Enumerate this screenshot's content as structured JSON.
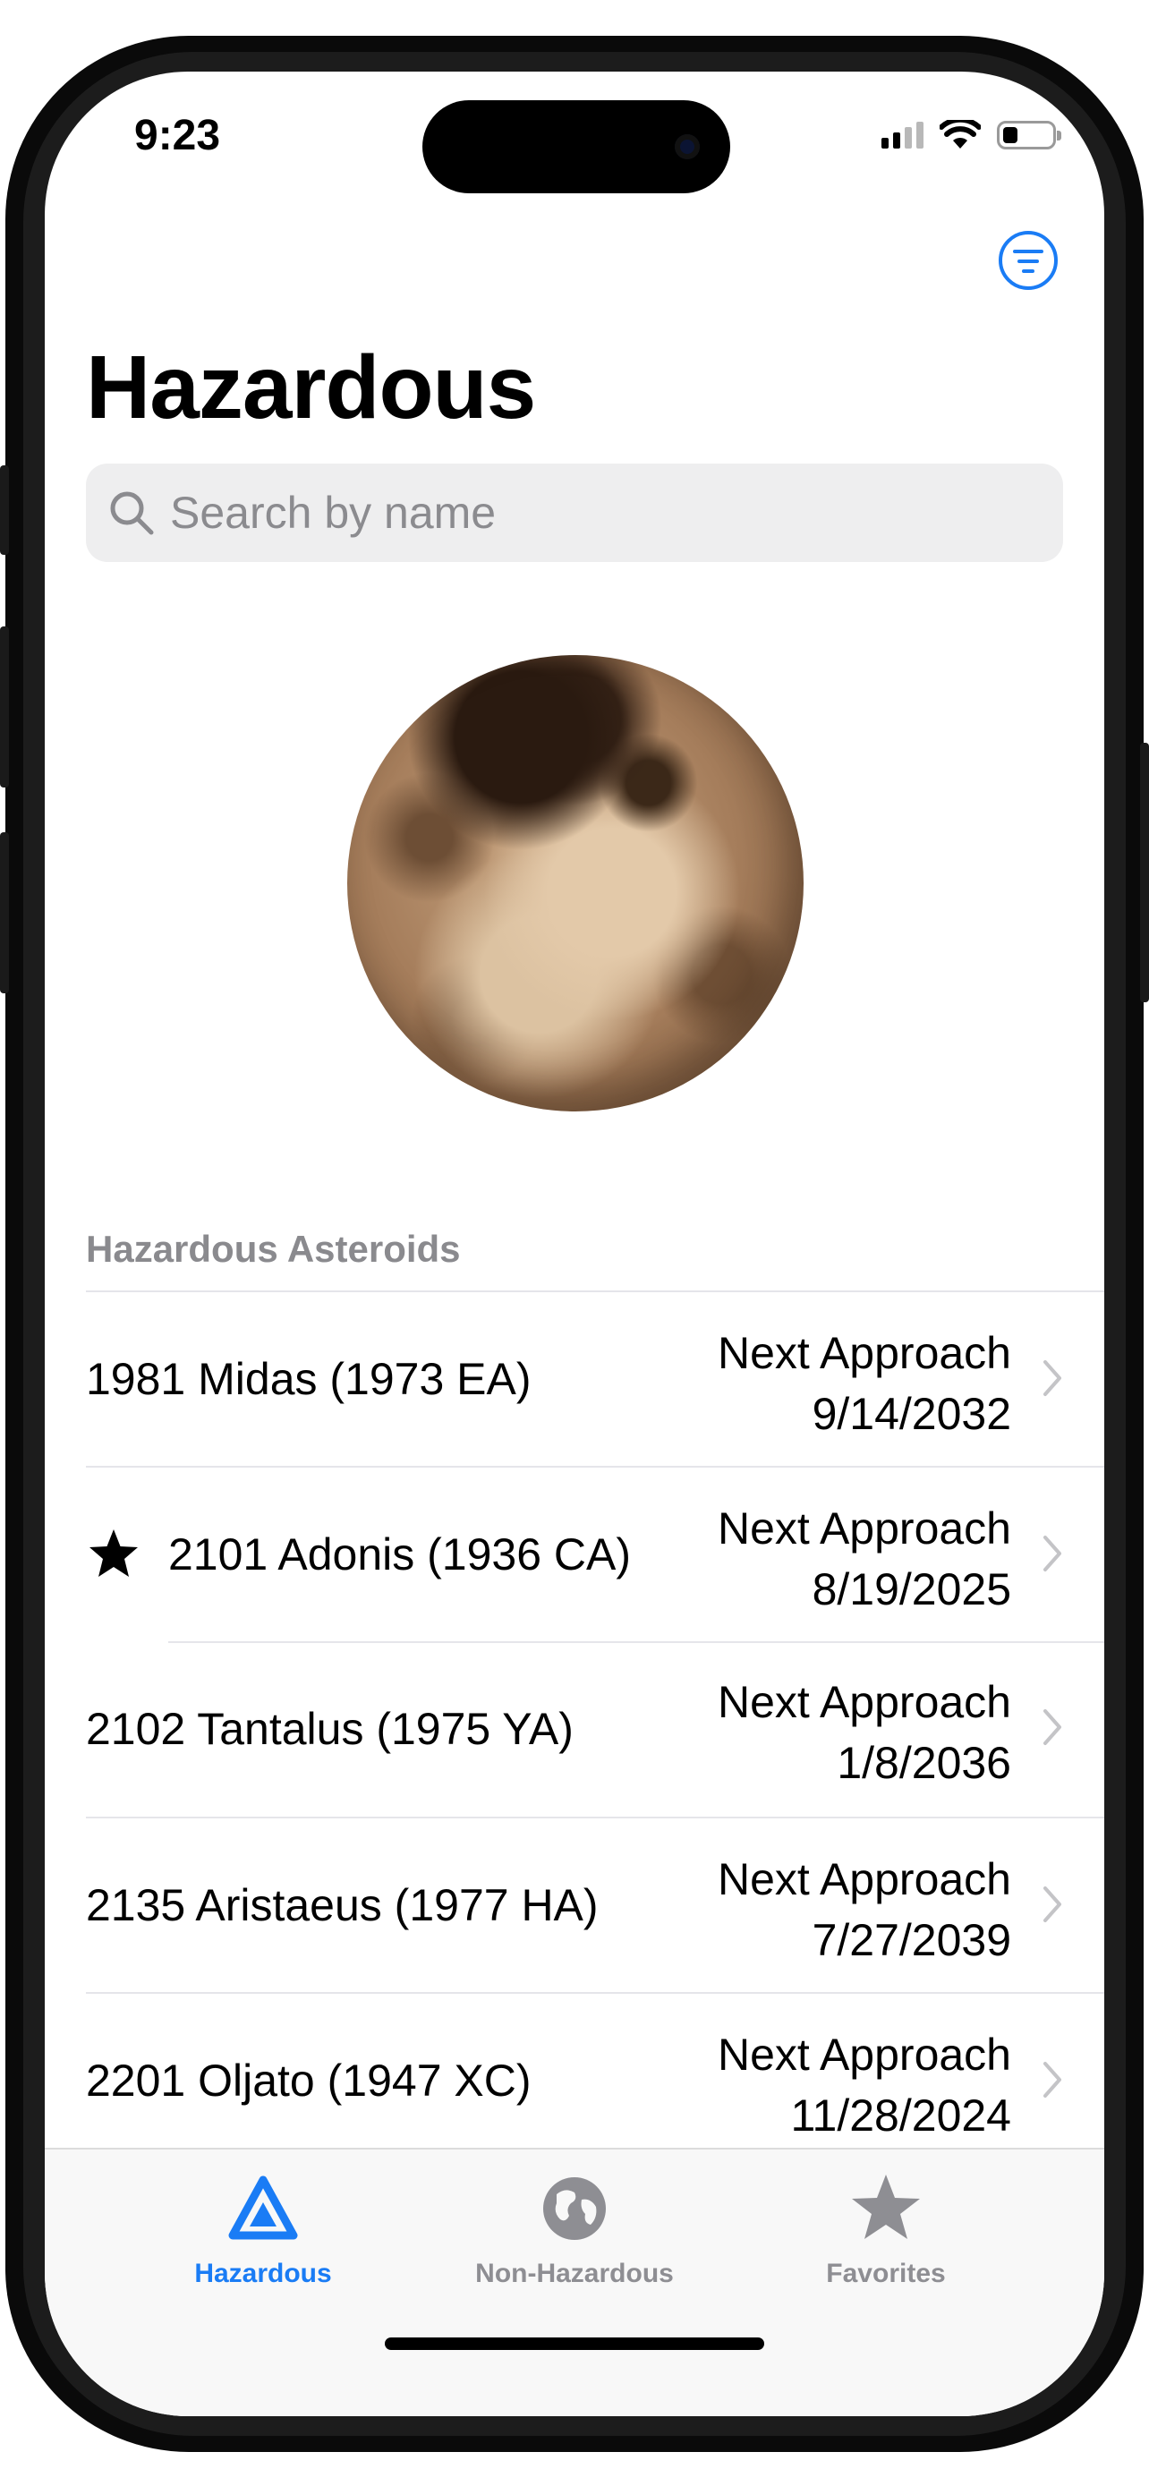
{
  "status_bar": {
    "time": "9:23"
  },
  "nav": {
    "title": "Hazardous",
    "filter_icon": "filter-circle-icon"
  },
  "search": {
    "placeholder": "Search by name",
    "value": ""
  },
  "section": {
    "header": "Hazardous Asteroids"
  },
  "asteroids": [
    {
      "name": "1981 Midas (1973 EA)",
      "approach_label": "Next Approach",
      "approach_date": "9/14/2032",
      "favorite": false
    },
    {
      "name": "2101 Adonis (1936 CA)",
      "approach_label": "Next Approach",
      "approach_date": "8/19/2025",
      "favorite": true
    },
    {
      "name": "2102 Tantalus (1975 YA)",
      "approach_label": "Next Approach",
      "approach_date": "1/8/2036",
      "favorite": false
    },
    {
      "name": "2135 Aristaeus (1977 HA)",
      "approach_label": "Next Approach",
      "approach_date": "7/27/2039",
      "favorite": false
    },
    {
      "name": "2201 Oljato (1947 XC)",
      "approach_label": "Next Approach",
      "approach_date": "11/28/2024",
      "favorite": false
    }
  ],
  "tabs": [
    {
      "label": "Hazardous",
      "icon": "warning-triangle-icon",
      "selected": true
    },
    {
      "label": "Non-Hazardous",
      "icon": "globe-icon",
      "selected": false
    },
    {
      "label": "Favorites",
      "icon": "star-icon",
      "selected": false
    }
  ],
  "colors": {
    "accent": "#1a7cf5",
    "inactive": "#8e8e93",
    "text": "#000000",
    "secondary": "#8a8a8e"
  }
}
